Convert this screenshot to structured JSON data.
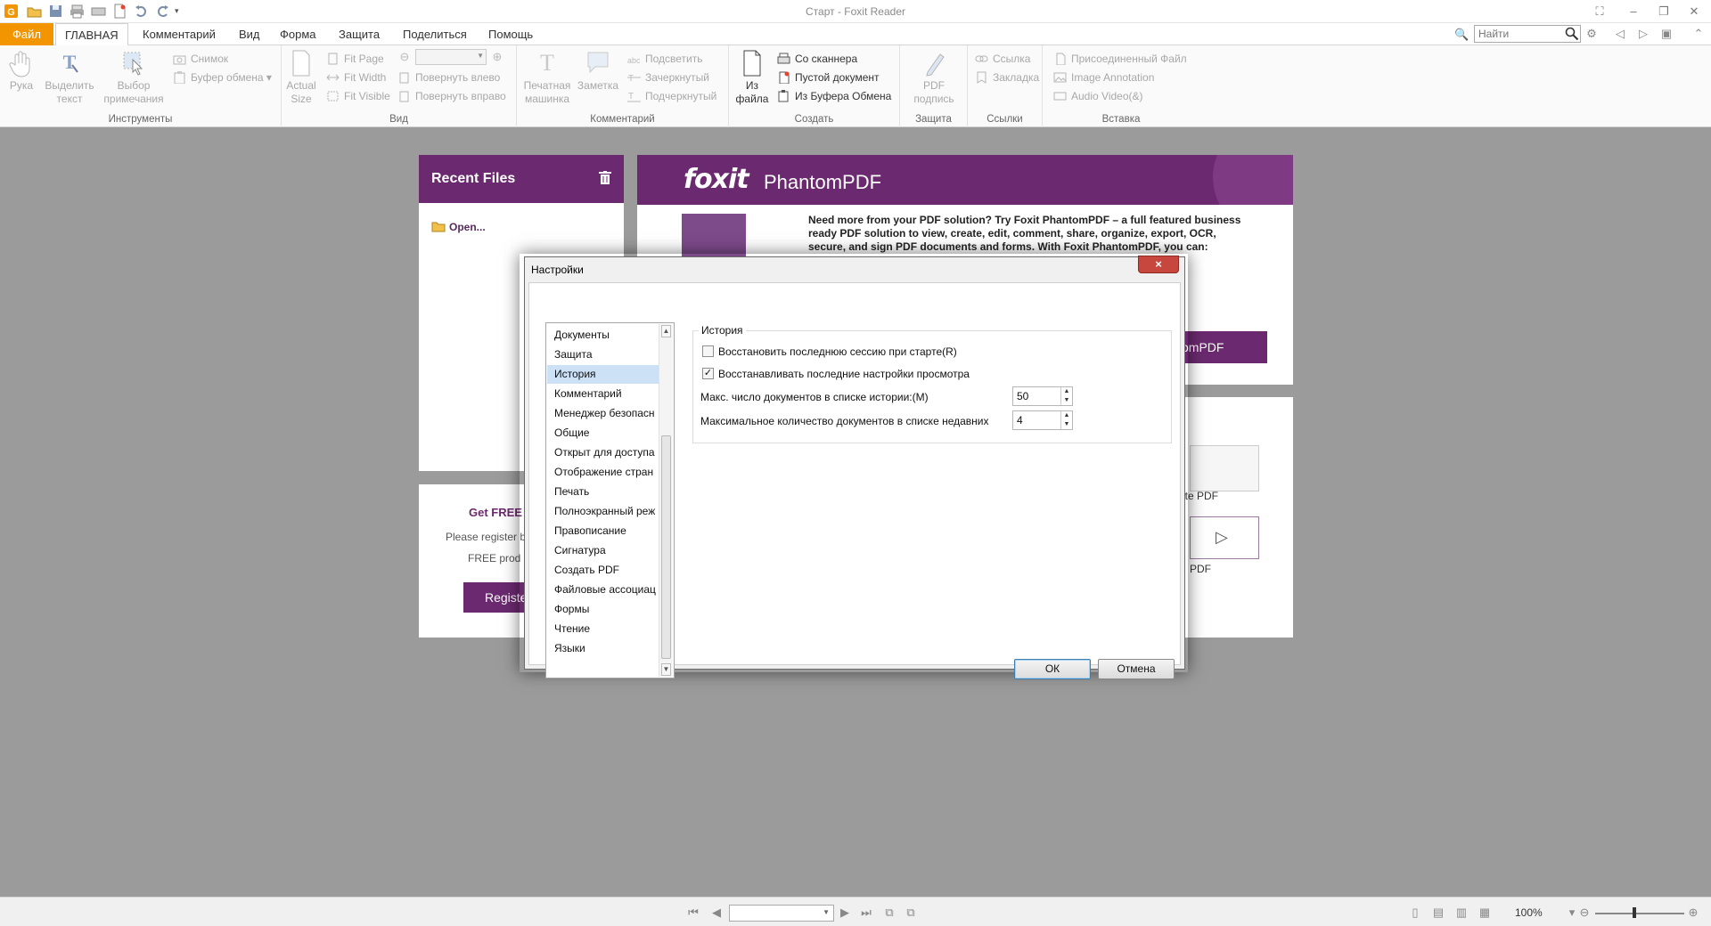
{
  "window": {
    "title": "Старт - Foxit Reader"
  },
  "tabs": [
    {
      "label": "Файл"
    },
    {
      "label": "ГЛАВНАЯ"
    },
    {
      "label": "Комментарий"
    },
    {
      "label": "Вид"
    },
    {
      "label": "Форма"
    },
    {
      "label": "Защита"
    },
    {
      "label": "Поделиться"
    },
    {
      "label": "Помощь"
    }
  ],
  "search": {
    "placeholder": "Найти"
  },
  "ribbon": {
    "tools": {
      "label": "Инструменты",
      "hand": "Рука",
      "select_text": "Выделить текст",
      "select_annot": "Выбор примечания",
      "snapshot": "Снимок",
      "clipboard": "Буфер обмена"
    },
    "view": {
      "label": "Вид",
      "actual_size": "Actual Size",
      "fit_page": "Fit Page",
      "fit_width": "Fit Width",
      "fit_visible": "Fit Visible",
      "rotate_left": "Повернуть влево",
      "rotate_right": "Повернуть вправо"
    },
    "comment": {
      "label": "Комментарий",
      "typewriter": "Печатная машинка",
      "note": "Заметка",
      "highlight": "Подсветить",
      "strikeout": "Зачеркнутый",
      "underline": "Подчеркнутый"
    },
    "create": {
      "label": "Создать",
      "from_file": "Из файла",
      "from_scanner": "Со сканнера",
      "blank": "Пустой документ",
      "from_clipboard": "Из Буфера Обмена"
    },
    "protect": {
      "label": "Защита",
      "pdf_sign": "PDF подпись"
    },
    "links": {
      "label": "Ссылки",
      "link": "Ссылка",
      "bookmark": "Закладка"
    },
    "insert": {
      "label": "Вставка",
      "attach_file": "Присоединенный Файл",
      "image_annotation": "Image Annotation",
      "audio_video": "Audio  Video(&)"
    }
  },
  "start": {
    "recent_title": "Recent Files",
    "open_label": "Open...",
    "getfree_title": "Get FREE",
    "getfree_text1": "Please register b",
    "getfree_text2": "FREE prod",
    "register_btn": "Registe",
    "product_name": "PhantomPDF",
    "logo_text": "foxit",
    "product_desc": "Need more from your PDF solution? Try Foxit PhantomPDF – a full featured business ready PDF solution to view, create, edit, comment, share, organize, export, OCR, secure, and sign PDF documents and forms. With Foxit PhantomPDF, you can:",
    "buy_btn": "omPDF",
    "tool1_label": "ate PDF",
    "tool2_label": "PDF"
  },
  "dialog": {
    "title": "Настройки",
    "close_glyph": "×",
    "nav_items": [
      "Документы",
      "Защита",
      "История",
      "Комментарий",
      "Менеджер безопасн",
      "Общие",
      "Открыт для доступа",
      "Отображение стран",
      "Печать",
      "Полноэкранный реж",
      "Правописание",
      "Сигнатура",
      "Создать PDF",
      "Файловые ассоциац",
      "Формы",
      "Чтение",
      "Языки"
    ],
    "selected_item": "История",
    "group_title": "История",
    "restore_session": {
      "label": "Восстановить последнюю сессию при старте(R)",
      "checked": false
    },
    "restore_view": {
      "label": "Восстанавливать последние настройки просмотра",
      "checked": true
    },
    "max_history": {
      "label": "Макс. число документов в списке истории:(M)",
      "value": "50"
    },
    "max_recent": {
      "label": "Максимальное количество документов в списке недавних",
      "value": "4"
    },
    "ok": "ОК",
    "cancel": "Отмена"
  },
  "statusbar": {
    "zoom": "100%"
  },
  "colors": {
    "accent": "#f39500",
    "brand": "#6b2a6f",
    "selection": "#cde1f6"
  }
}
